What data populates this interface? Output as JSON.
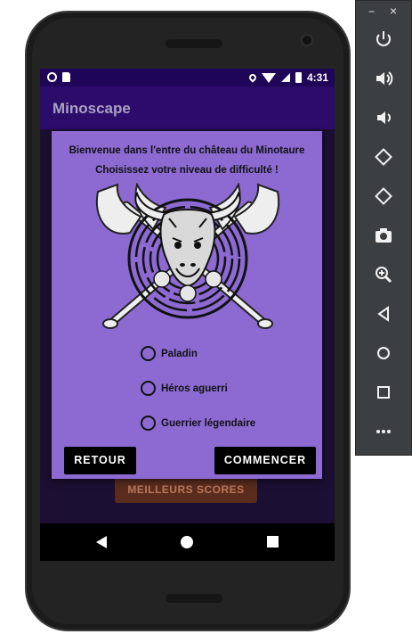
{
  "status_bar": {
    "time": "4:31"
  },
  "app": {
    "title": "Minoscape"
  },
  "dialog": {
    "title": "Bienvenue dans l'entre du château du Minotaure",
    "subtitle": "Choisissez votre niveau de difficulté !",
    "options": [
      "Paladin",
      "Héros aguerri",
      "Guerrier légendaire"
    ],
    "back_button": "RETOUR",
    "start_button": "COMMENCER"
  },
  "background_button": {
    "label": "MEILLEURS SCORES"
  },
  "emulator_panel": {
    "minimize": "−",
    "close": "×",
    "tools": [
      "power-icon",
      "volume-up-icon",
      "volume-down-icon",
      "rotate-left-icon",
      "rotate-right-icon",
      "camera-icon",
      "zoom-icon",
      "back-icon",
      "home-icon",
      "overview-icon",
      "more-icon"
    ]
  },
  "colors": {
    "accent": "#2d0b6b",
    "dialog_bg": "#8c6ad2",
    "status_bar": "#1e0558"
  }
}
